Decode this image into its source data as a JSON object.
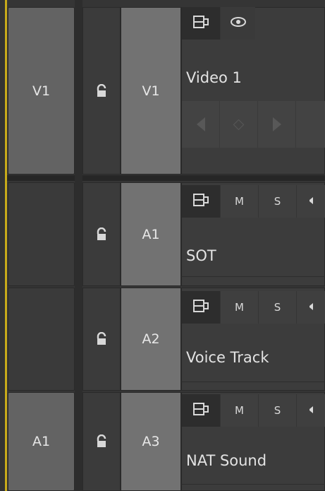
{
  "tracks": {
    "video": [
      {
        "source_label": "V1",
        "target_label": "V1",
        "name": "Video 1",
        "buttons": {
          "sync_icon": "toggle-sync-lock-icon",
          "eye_icon": "eye-icon"
        },
        "keyframe_nav": {
          "prev_icon": "triangle-left-icon",
          "add_icon": "diamond-icon",
          "next_icon": "triangle-right-icon"
        }
      }
    ],
    "audio": [
      {
        "source_label": "",
        "target_label": "A1",
        "name": "SOT",
        "mute_label": "M",
        "solo_label": "S"
      },
      {
        "source_label": "",
        "target_label": "A2",
        "name": "Voice Track",
        "mute_label": "M",
        "solo_label": "S"
      },
      {
        "source_label": "A1",
        "target_label": "A3",
        "name": "NAT Sound",
        "mute_label": "M",
        "solo_label": "S"
      }
    ]
  },
  "colors": {
    "accent_yellow": "#c8aa1a",
    "panel_bg": "#3c3c3c",
    "target_bg": "#727272",
    "source_bg": "#636363"
  }
}
